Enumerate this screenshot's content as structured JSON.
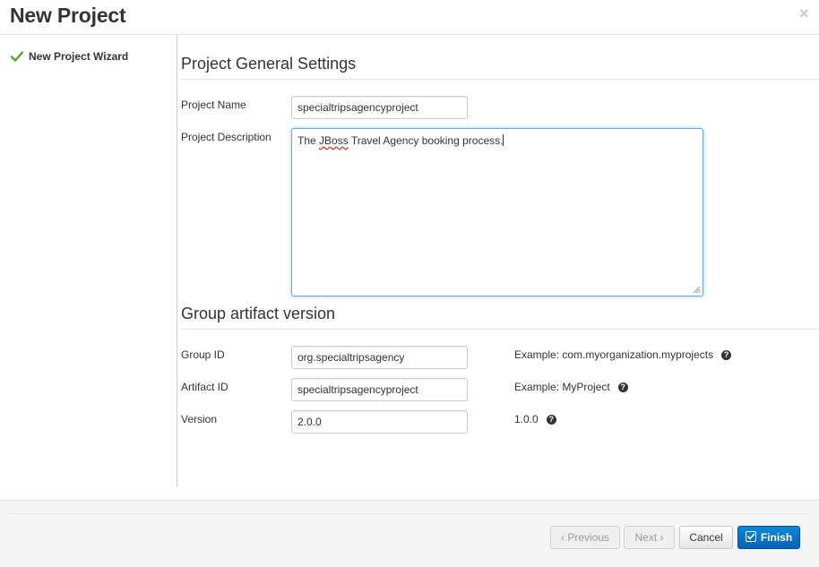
{
  "dialog": {
    "title": "New Project",
    "close_glyph": "×"
  },
  "sidebar": {
    "items": [
      {
        "label": "New Project Wizard",
        "icon": "checkmark-icon",
        "completed": true
      }
    ]
  },
  "general_settings": {
    "heading": "Project General Settings",
    "project_name_label": "Project Name",
    "project_name_value": "specialtripsagencyproject",
    "project_description_label": "Project Description",
    "project_description_prefix": "The ",
    "project_description_misspelled": "JBoss",
    "project_description_suffix": " Travel Agency booking process."
  },
  "gav": {
    "heading": "Group artifact version",
    "group_id_label": "Group ID",
    "group_id_value": "org.specialtripsagency",
    "group_id_hint": "Example: com.myorganization.myprojects",
    "artifact_id_label": "Artifact ID",
    "artifact_id_value": "specialtripsagencyproject",
    "artifact_id_hint": "Example: MyProject",
    "version_label": "Version",
    "version_value": "2.0.0",
    "version_hint": "1.0.0",
    "help_glyph": "?"
  },
  "footer": {
    "previous_label": "Previous",
    "previous_icon": "‹",
    "next_label": "Next",
    "next_icon": "›",
    "cancel_label": "Cancel",
    "finish_label": "Finish"
  },
  "colors": {
    "primary_button": "#0562b8",
    "focus_border": "#6fa7d6",
    "check_green": "#5aa02c"
  }
}
